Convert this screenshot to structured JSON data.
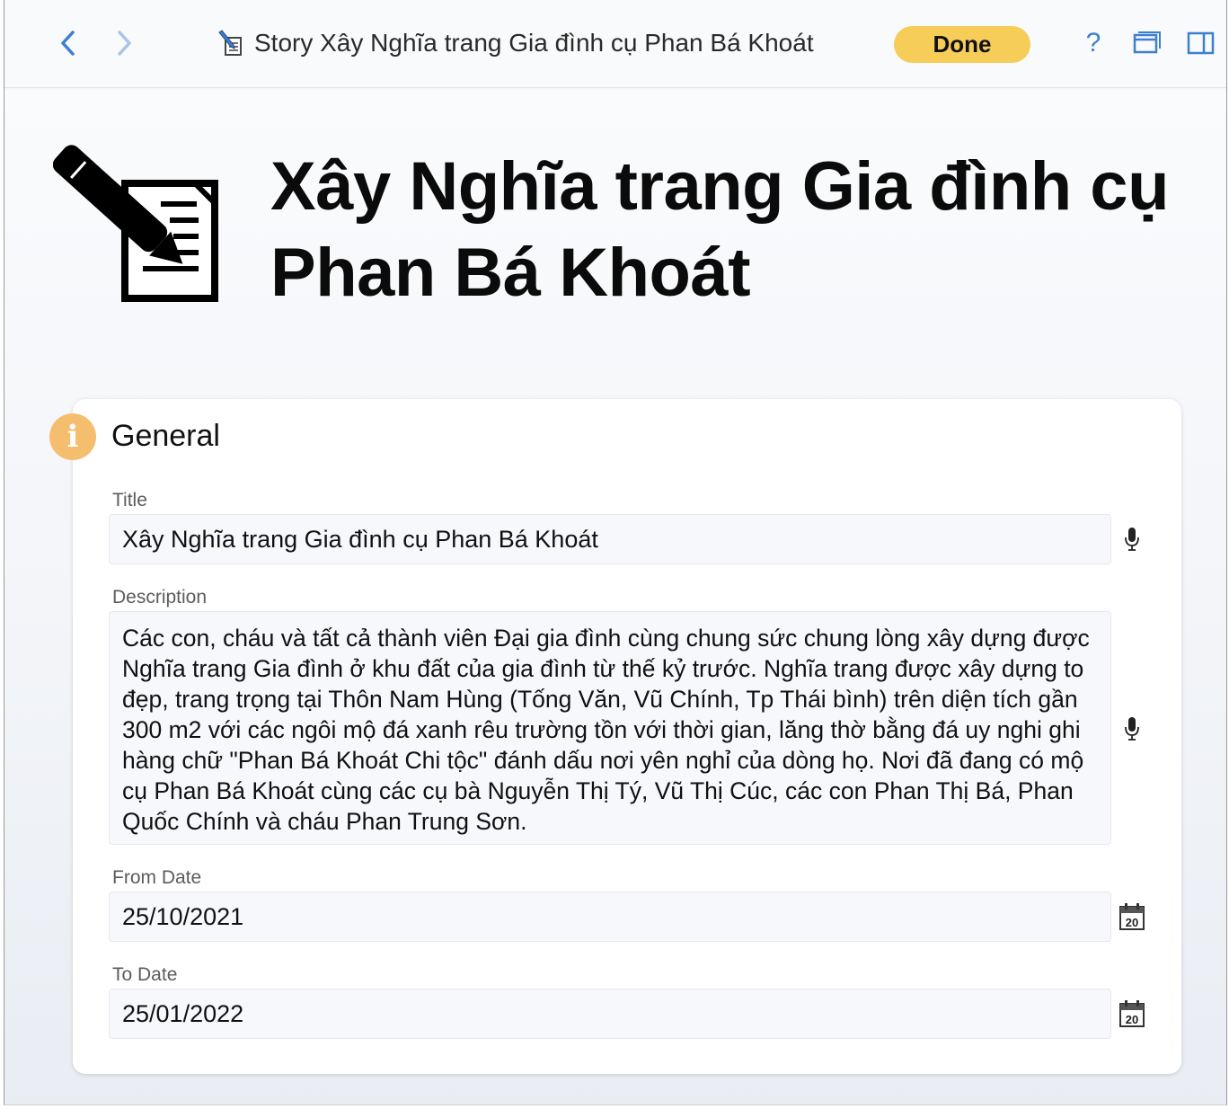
{
  "toolbar": {
    "breadcrumb": "Story Xây Nghĩa trang Gia đình cụ Phan Bá Khoát",
    "done_label": "Done",
    "help_label": "?",
    "icons": [
      "chevron-left-icon",
      "chevron-right-icon",
      "story-edit-icon",
      "help-icon",
      "window-icon",
      "sidebar-icon"
    ]
  },
  "header": {
    "title": "Xây Nghĩa trang Gia đình cụ Phan Bá Khoát",
    "icon": "pencil-document-icon"
  },
  "section": {
    "title": "General",
    "badge": "i",
    "fields": {
      "title": {
        "label": "Title",
        "value": "Xây Nghĩa trang Gia đình cụ Phan Bá Khoát"
      },
      "description": {
        "label": "Description",
        "value": "Các con, cháu và tất cả thành viên Đại gia đình cùng chung sức chung lòng xây dựng được Nghĩa trang Gia đình ở khu đất của gia đình từ thế kỷ trước. Nghĩa trang được xây dựng to đẹp, trang trọng tại Thôn Nam Hùng (Tống Văn, Vũ Chính, Tp Thái bình) trên diện tích gần 300 m2 với các ngôi mộ đá xanh rêu trường tồn với thời gian, lăng thờ bằng đá uy nghi ghi hàng chữ \"Phan Bá Khoát Chi tộc\" đánh dấu nơi yên nghỉ của dòng họ. Nơi đã đang có mộ cụ Phan Bá Khoát cùng các cụ bà Nguyễn Thị Tý, Vũ Thị Cúc, các con Phan Thị Bá, Phan Quốc Chính và cháu Phan Trung Sơn."
      },
      "from_date": {
        "label": "From Date",
        "value": "25/10/2021"
      },
      "to_date": {
        "label": "To Date",
        "value": "25/01/2022"
      }
    },
    "calendar_day": "20"
  },
  "colors": {
    "accent_blue": "#3d7fd2",
    "done_yellow": "#f7cd5a",
    "info_orange": "#f5be6f"
  }
}
